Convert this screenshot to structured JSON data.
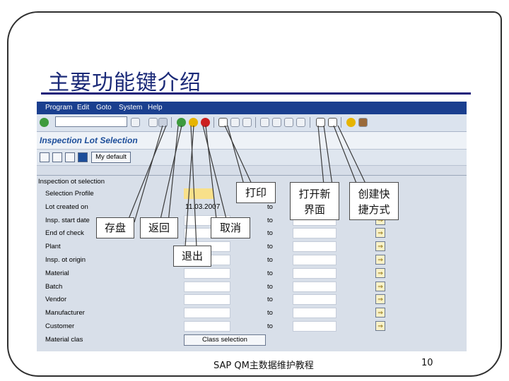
{
  "slide": {
    "title": "主要功能键介绍",
    "footer_text": "SAP QM主数据维护教程",
    "page_number": "10"
  },
  "sap": {
    "menu": [
      "Program",
      "Edit",
      "Goto",
      "System",
      "Help"
    ],
    "screen_title": "Inspection Lot Selection",
    "app_button": "My default",
    "group_title": "Inspection ot selection",
    "date_value": "11.03.2007",
    "to_label": "to",
    "rows": [
      {
        "label": "Selection Profile"
      },
      {
        "label": "Lot created on"
      },
      {
        "label": "Insp. start date"
      },
      {
        "label": "End of check"
      },
      {
        "label": "Plant"
      },
      {
        "label": "Insp. ot origin"
      },
      {
        "label": "Material"
      },
      {
        "label": "Batch"
      },
      {
        "label": "Vendor"
      },
      {
        "label": "Manufacturer"
      },
      {
        "label": "Customer"
      },
      {
        "label": "Material clas"
      }
    ],
    "class_button": "Class selection"
  },
  "callouts": {
    "save": "存盘",
    "back": "返回",
    "exit": "退出",
    "cancel": "取消",
    "print": "打印",
    "new_session": "打开新界面",
    "shortcut": "创建快捷方式"
  }
}
